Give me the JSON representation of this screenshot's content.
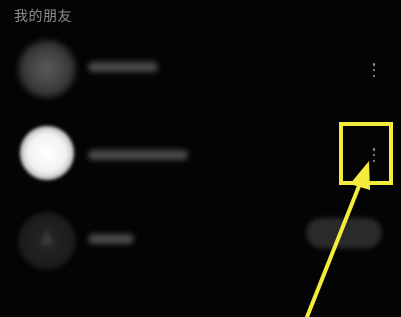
{
  "section_title": "我的朋友",
  "friends": [
    {
      "avatar": "blurred-photo",
      "more_menu": "more-vertical-icon"
    },
    {
      "avatar": "bright-photo",
      "more_menu": "more-vertical-icon",
      "highlighted": true
    },
    {
      "avatar": "default-avatar",
      "action": "blurred-button"
    }
  ],
  "annotation": {
    "color": "#f3ec3c",
    "target": "more-vertical-icon"
  }
}
